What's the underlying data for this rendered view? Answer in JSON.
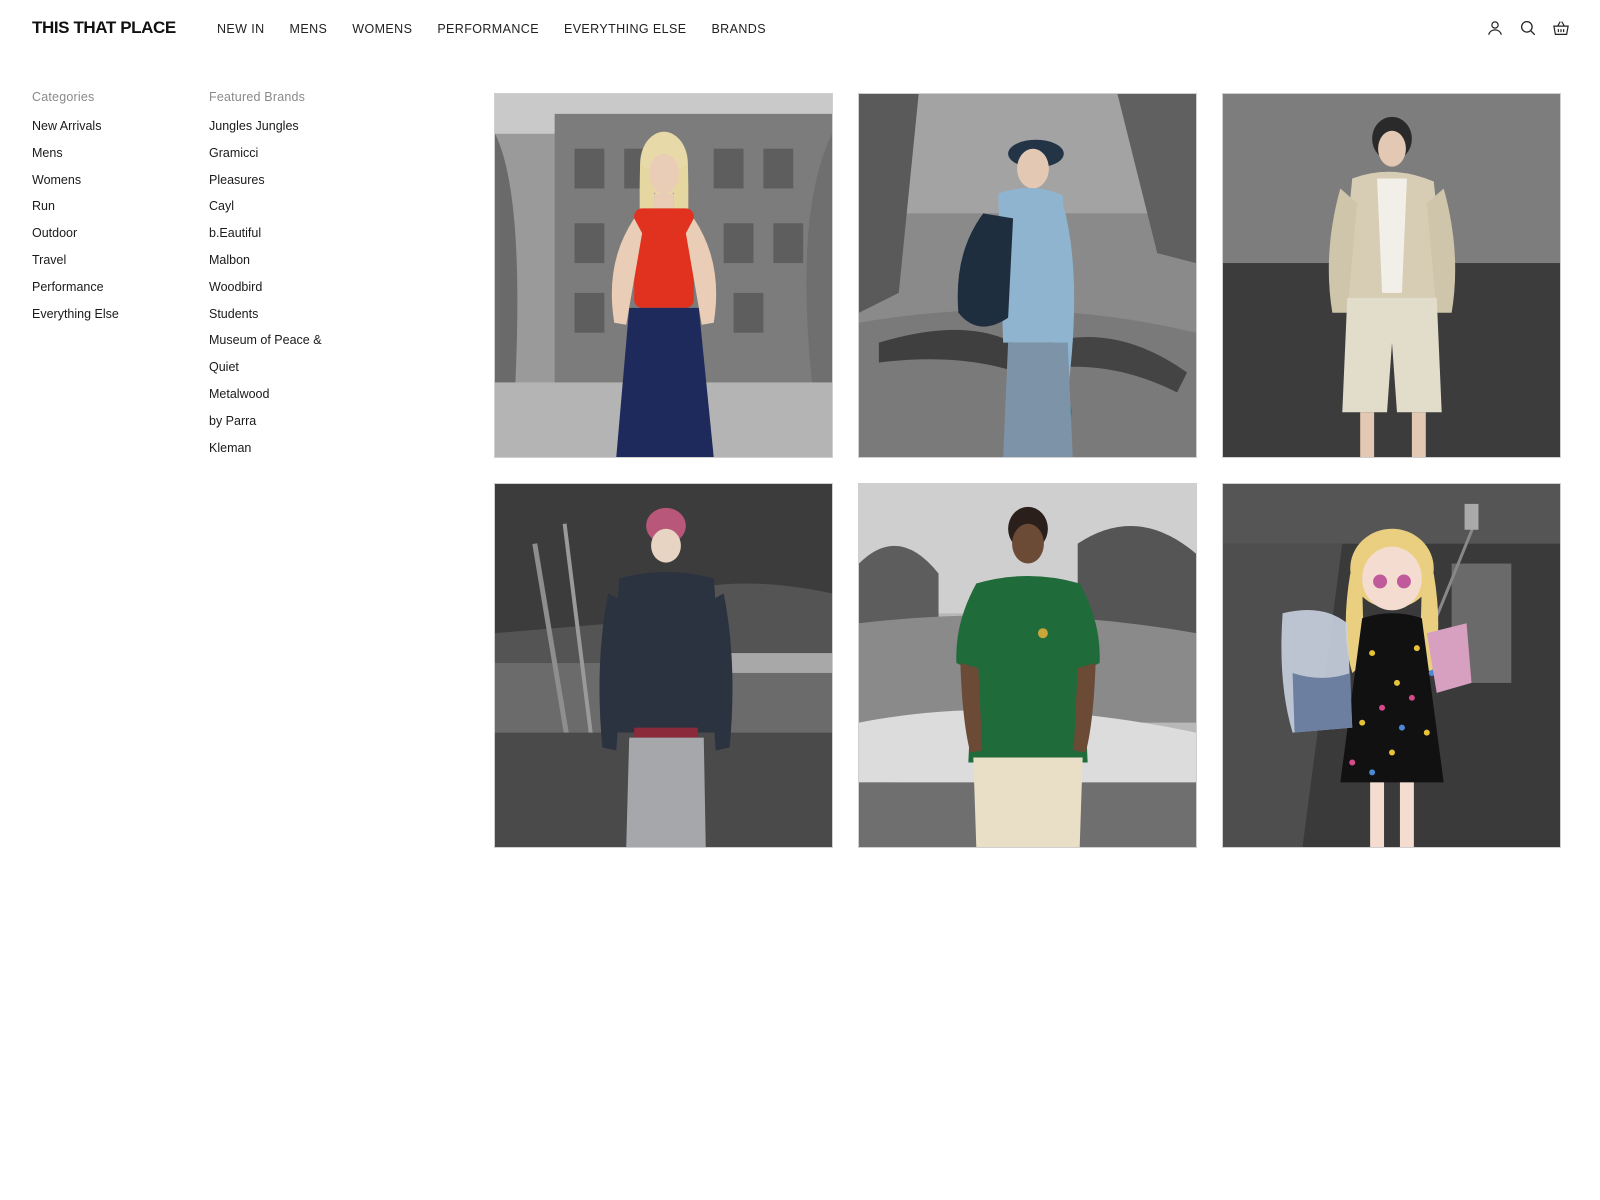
{
  "header": {
    "logo": "THIS THAT PLACE",
    "nav": [
      "NEW IN",
      "MENS",
      "WOMENS",
      "PERFORMANCE",
      "EVERYTHING ELSE",
      "BRANDS"
    ],
    "icons": [
      "account-icon",
      "search-icon",
      "basket-icon"
    ]
  },
  "menu": {
    "categories": {
      "heading": "Categories",
      "items": [
        "New Arrivals",
        "Mens",
        "Womens",
        "Run",
        "Outdoor",
        "Travel",
        "Performance",
        "Everything Else"
      ]
    },
    "brands": {
      "heading": "Featured Brands",
      "items": [
        "Jungles Jungles",
        "Gramicci",
        "Pleasures",
        "Cayl",
        "b.Eautiful",
        "Malbon",
        "Woodbird",
        "Students",
        "Museum of Peace &",
        "Quiet",
        "Metalwood",
        "by Parra",
        "Kleman"
      ]
    }
  },
  "colors": {
    "accent_red_top": "#e0321f",
    "navy_pants": "#1e2a5c",
    "light_blue_hoodie": "#8fb4cf",
    "beige_denim": "#d6cdb4",
    "pink_beanie": "#b8577a",
    "green_polo": "#1f6b3a"
  }
}
